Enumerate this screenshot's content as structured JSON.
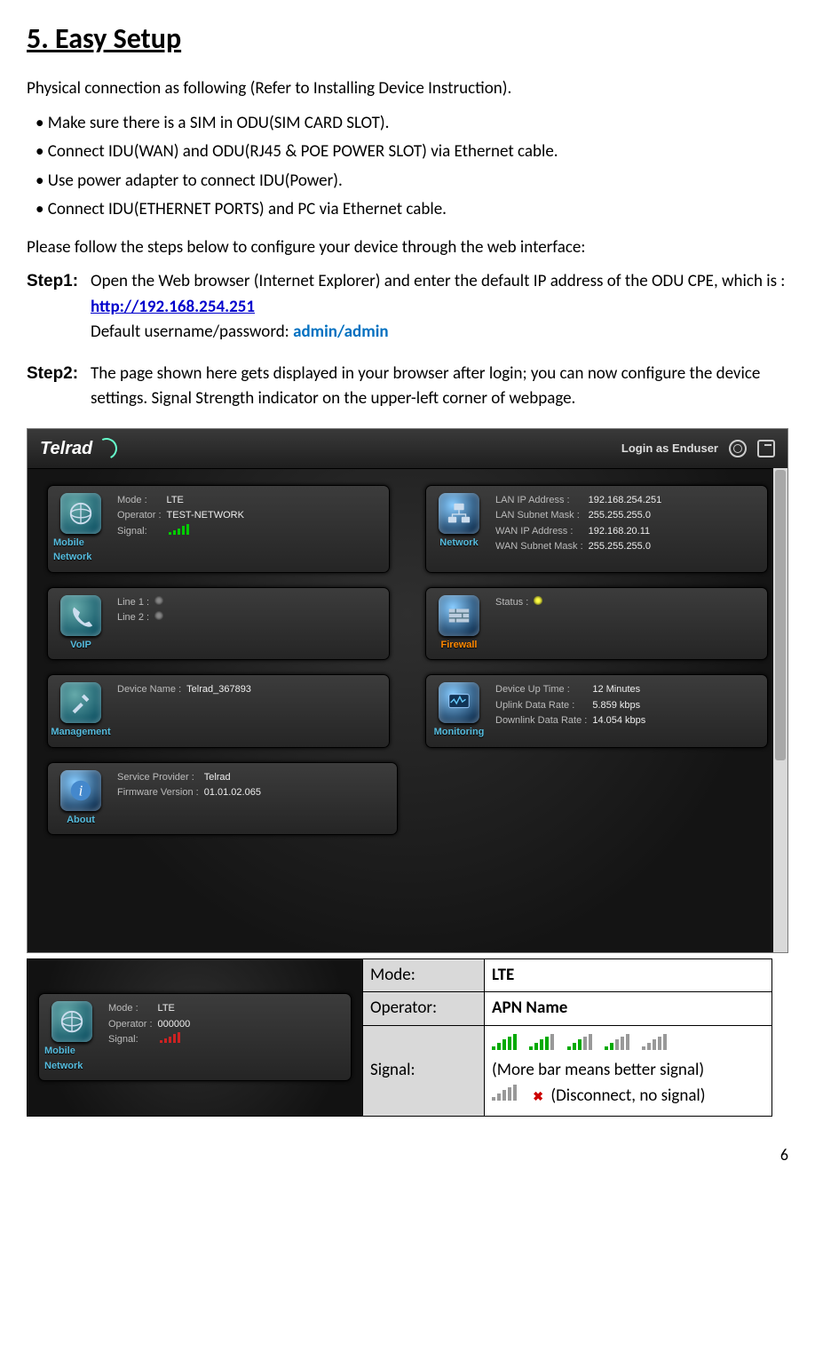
{
  "heading": "5. Easy Setup",
  "intro": "Physical connection as following (Refer to Installing Device Instruction).",
  "bullets": [
    "• Make sure there is a SIM in ODU(SIM CARD SLOT).",
    "• Connect IDU(WAN) and ODU(RJ45 & POE POWER SLOT) via Ethernet cable.",
    "• Use power adapter to connect IDU(Power).",
    "• Connect IDU(ETHERNET PORTS) and PC via Ethernet cable."
  ],
  "follow": "Please follow the steps below to configure your device through the web interface:",
  "step1": {
    "label": "Step1:",
    "text_a": "Open the Web browser (Internet Explorer) and enter the default IP address of the ODU CPE, which is : ",
    "link": "http://192.168.254.251",
    "text_b": "Default username/password: ",
    "cred": "admin/admin"
  },
  "step2": {
    "label": "Step2:",
    "text": "The page shown here gets displayed in your browser after login; you can now configure the device settings. Signal Strength indicator on the upper-left corner of webpage."
  },
  "screenshot": {
    "logo": "Telrad",
    "login_as": "Login as Enduser",
    "cards": {
      "mobile": {
        "label": "Mobile Network",
        "mode_k": "Mode :",
        "mode_v": "LTE",
        "op_k": "Operator :",
        "op_v": "TEST-NETWORK",
        "sig_k": "Signal:"
      },
      "network": {
        "label": "Network",
        "lanip_k": "LAN IP Address :",
        "lanip_v": "192.168.254.251",
        "lanmask_k": "LAN Subnet Mask :",
        "lanmask_v": "255.255.255.0",
        "wanip_k": "WAN IP Address :",
        "wanip_v": "192.168.20.11",
        "wanmask_k": "WAN Subnet Mask :",
        "wanmask_v": "255.255.255.0"
      },
      "voip": {
        "label": "VoIP",
        "l1": "Line 1 :",
        "l2": "Line 2 :"
      },
      "firewall": {
        "label": "Firewall",
        "status_k": "Status :"
      },
      "management": {
        "label": "Management",
        "dn_k": "Device Name :",
        "dn_v": "Telrad_367893"
      },
      "monitoring": {
        "label": "Monitoring",
        "up_k": "Device Up Time :",
        "up_v": "12 Minutes",
        "ul_k": "Uplink Data Rate :",
        "ul_v": "5.859  kbps",
        "dl_k": "Downlink Data Rate :",
        "dl_v": "14.054  kbps"
      },
      "about": {
        "label": "About",
        "sp_k": "Service Provider :",
        "sp_v": "Telrad",
        "fw_k": "Firmware Version :",
        "fw_v": "01.01.02.065"
      }
    }
  },
  "bottom_card": {
    "mode_k": "Mode :",
    "mode_v": "LTE",
    "op_k": "Operator :",
    "op_v": "000000",
    "sig_k": "Signal:",
    "label": "Mobile Network"
  },
  "table": {
    "mode_k": "Mode:",
    "mode_v": "LTE",
    "op_k": "Operator:",
    "op_v": "APN Name",
    "sig_k": "Signal:",
    "sig_note1": "(More bar means better signal)",
    "sig_note2": "(Disconnect, no signal)"
  },
  "page_number": "6"
}
